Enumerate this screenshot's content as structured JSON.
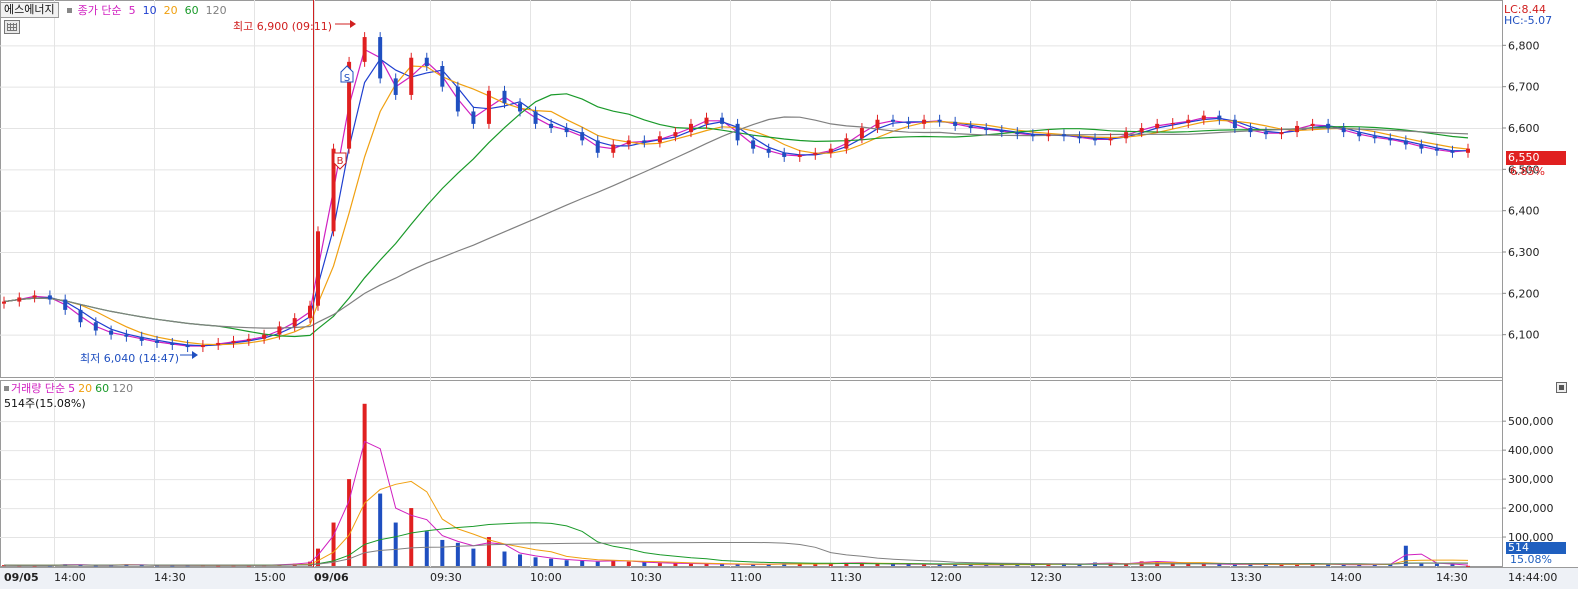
{
  "header": {
    "stock_name": "에스에너지",
    "price_indicator": "종가 단순",
    "volume_indicator": "거래량 단순",
    "volume_summary": "514주(15.08%)",
    "lc": "LC:8.44",
    "hc": "HC:-5.07"
  },
  "ma_price": [
    {
      "label": "5",
      "color": "#d020c0"
    },
    {
      "label": "10",
      "color": "#1f3fd0"
    },
    {
      "label": "20",
      "color": "#f0a010"
    },
    {
      "label": "60",
      "color": "#1a9a2a"
    },
    {
      "label": "120",
      "color": "#808080"
    }
  ],
  "ma_volume": [
    {
      "label": "5",
      "color": "#d020c0"
    },
    {
      "label": "20",
      "color": "#f0a010"
    },
    {
      "label": "60",
      "color": "#1a9a2a"
    },
    {
      "label": "120",
      "color": "#808080"
    }
  ],
  "annotations": {
    "high": "최고 6,900 (09:11)",
    "low": "최저 6,040 (14:47)",
    "buy_marker": "B",
    "sell_marker": "S"
  },
  "last": {
    "price": "6,550",
    "change_pct": "6.85%",
    "volume": "514",
    "volume_pct": "15.08%"
  },
  "colors": {
    "up": "#e02020",
    "down": "#1f4fc0",
    "grid": "#e4e4e4",
    "separator": "#d02020"
  },
  "chart_data": [
    {
      "type": "candlestick",
      "title": "에스에너지",
      "y_ticks": [
        6100,
        6200,
        6300,
        6400,
        6500,
        6600,
        6700,
        6800
      ],
      "ylim": [
        6000,
        6900
      ],
      "x_ticks": [
        "09/05",
        "14:00",
        "14:30",
        "15:00",
        "09/06",
        "09:30",
        "10:00",
        "10:30",
        "11:00",
        "11:30",
        "12:00",
        "12:30",
        "13:00",
        "13:30",
        "14:00",
        "14:30",
        "14:44:00"
      ],
      "high": 6900,
      "low": 6040,
      "close": [
        6180,
        6190,
        6195,
        6185,
        6160,
        6130,
        6110,
        6100,
        6095,
        6085,
        6080,
        6075,
        6070,
        6075,
        6080,
        6085,
        6090,
        6100,
        6120,
        6140,
        6170,
        6350,
        6550,
        6760,
        6820,
        6720,
        6680,
        6770,
        6750,
        6700,
        6640,
        6610,
        6690,
        6660,
        6640,
        6610,
        6600,
        6590,
        6570,
        6540,
        6560,
        6570,
        6565,
        6580,
        6590,
        6610,
        6625,
        6610,
        6570,
        6550,
        6540,
        6530,
        6535,
        6540,
        6550,
        6575,
        6600,
        6620,
        6615,
        6610,
        6620,
        6615,
        6605,
        6600,
        6595,
        6590,
        6585,
        6580,
        6585,
        6580,
        6575,
        6570,
        6575,
        6590,
        6600,
        6610,
        6612,
        6620,
        6630,
        6620,
        6600,
        6590,
        6585,
        6590,
        6605,
        6610,
        6600,
        6590,
        6580,
        6575,
        6570,
        6560,
        6550,
        6545,
        6540,
        6550
      ],
      "volume": [
        3000,
        2500,
        2000,
        2200,
        6000,
        4000,
        2000,
        2500,
        6000,
        3000,
        2500,
        2000,
        2500,
        3000,
        2000,
        2500,
        2000,
        3000,
        5000,
        8000,
        15000,
        60000,
        150000,
        300000,
        560000,
        250000,
        150000,
        200000,
        120000,
        90000,
        80000,
        60000,
        100000,
        50000,
        40000,
        30000,
        25000,
        20000,
        18000,
        15000,
        20000,
        15000,
        12000,
        10000,
        9000,
        8000,
        7000,
        7000,
        6000,
        5000,
        6000,
        9000,
        8000,
        7000,
        9000,
        12000,
        10000,
        8000,
        6000,
        7000,
        5000,
        6000,
        5000,
        5000,
        4000,
        5000,
        6000,
        4000,
        9000,
        7000,
        5000,
        12000,
        8000,
        8000,
        16000,
        15000,
        12000,
        8000,
        7000,
        6000,
        5000,
        6000,
        5000,
        6000,
        6000,
        7000,
        6000,
        4000,
        5000,
        5000,
        6000,
        70000,
        12000,
        8000,
        6000,
        514
      ],
      "legend": [
        "종가 단순 5",
        "10",
        "20",
        "60",
        "120"
      ]
    },
    {
      "type": "bar",
      "title": "거래량",
      "y_ticks": [
        100000,
        200000,
        300000,
        400000,
        500000
      ],
      "ylim": [
        0,
        580000
      ]
    }
  ]
}
